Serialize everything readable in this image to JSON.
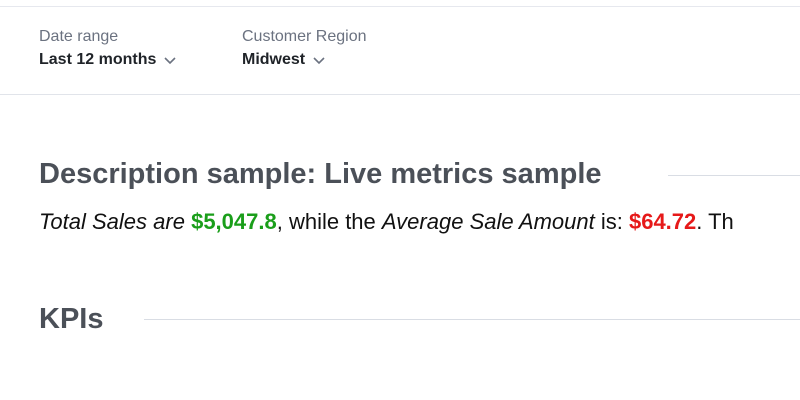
{
  "filters": [
    {
      "label": "Date range",
      "value": "Last 12 months"
    },
    {
      "label": "Customer Region",
      "value": "Midwest"
    }
  ],
  "sections": {
    "description_title": "Description sample: Live metrics sample",
    "kpis_title": "KPIs"
  },
  "description": {
    "part1": "Total Sales are",
    "total_sales": "$5,047.8",
    "part2": ", while the",
    "part3": "Average Sale Amount",
    "part4": " is:",
    "avg_sale": "$64.72",
    "part5": ". Th"
  },
  "colors": {
    "positive": "#1a9e1a",
    "negative": "#e61919"
  },
  "icons": {
    "dropdown": "chevron-down-icon"
  }
}
